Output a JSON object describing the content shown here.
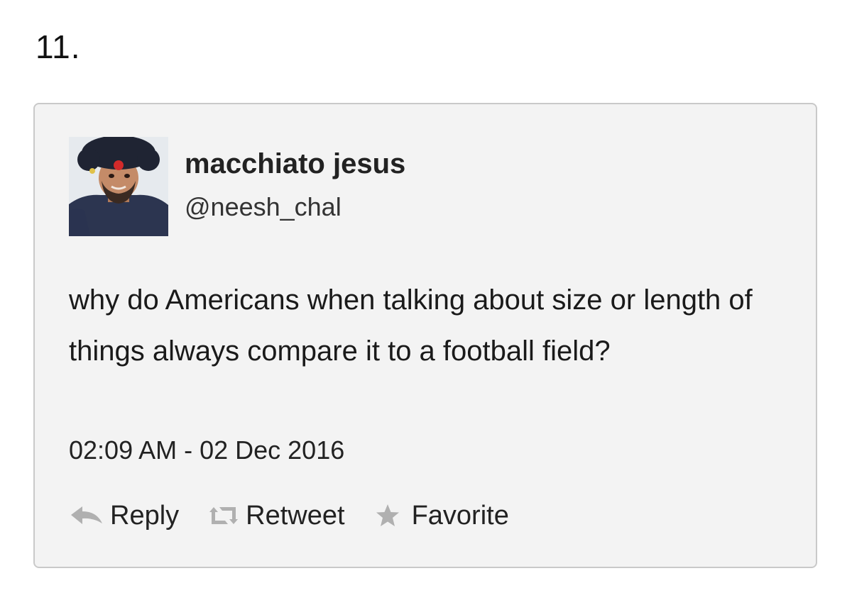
{
  "list_number": "11.",
  "tweet": {
    "display_name": "macchiato jesus",
    "handle": "@neesh_chal",
    "text": "why do Americans when talking about size or length of things always compare it to a football field?",
    "timestamp": "02:09 AM - 02 Dec 2016",
    "actions": {
      "reply_label": "Reply",
      "retweet_label": "Retweet",
      "favorite_label": "Favorite"
    }
  },
  "icons": {
    "reply": "reply-arrow-icon",
    "retweet": "retweet-icon",
    "favorite": "star-icon"
  },
  "colors": {
    "card_background": "#f3f3f3",
    "card_border": "#c9c9c9",
    "icon_gray": "#b0b0b0"
  }
}
